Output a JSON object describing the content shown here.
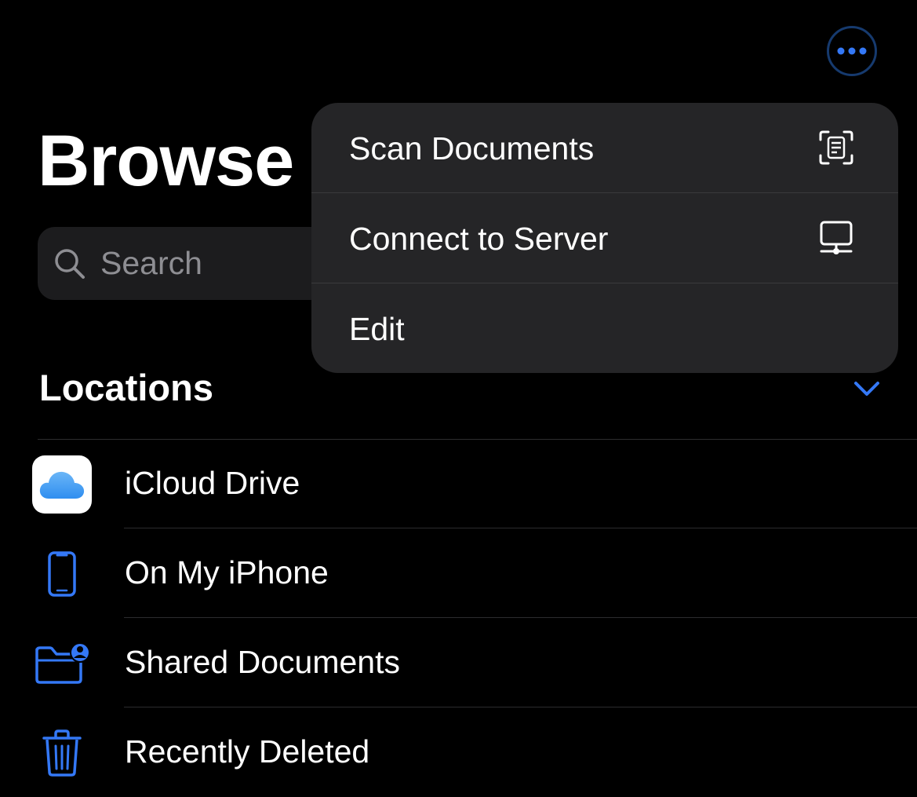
{
  "header": {
    "title": "Browse",
    "more_icon": "ellipsis-circle-icon"
  },
  "search": {
    "placeholder": "Search",
    "icon": "magnifying-glass-icon"
  },
  "locations": {
    "header": "Locations",
    "chevron_icon": "chevron-down-icon",
    "items": [
      {
        "label": "iCloud Drive",
        "icon": "icloud-icon"
      },
      {
        "label": "On My iPhone",
        "icon": "iphone-icon"
      },
      {
        "label": "Shared Documents",
        "icon": "shared-folder-icon"
      },
      {
        "label": "Recently Deleted",
        "icon": "trash-icon"
      }
    ]
  },
  "menu": {
    "items": [
      {
        "label": "Scan Documents",
        "icon": "document-scanner-icon"
      },
      {
        "label": "Connect to Server",
        "icon": "server-icon"
      },
      {
        "label": "Edit",
        "icon": ""
      }
    ]
  },
  "colors": {
    "background": "#000000",
    "accent": "#3478f6",
    "menu_background": "#252527",
    "search_background": "#1c1c1e",
    "placeholder": "#8e8e93"
  }
}
